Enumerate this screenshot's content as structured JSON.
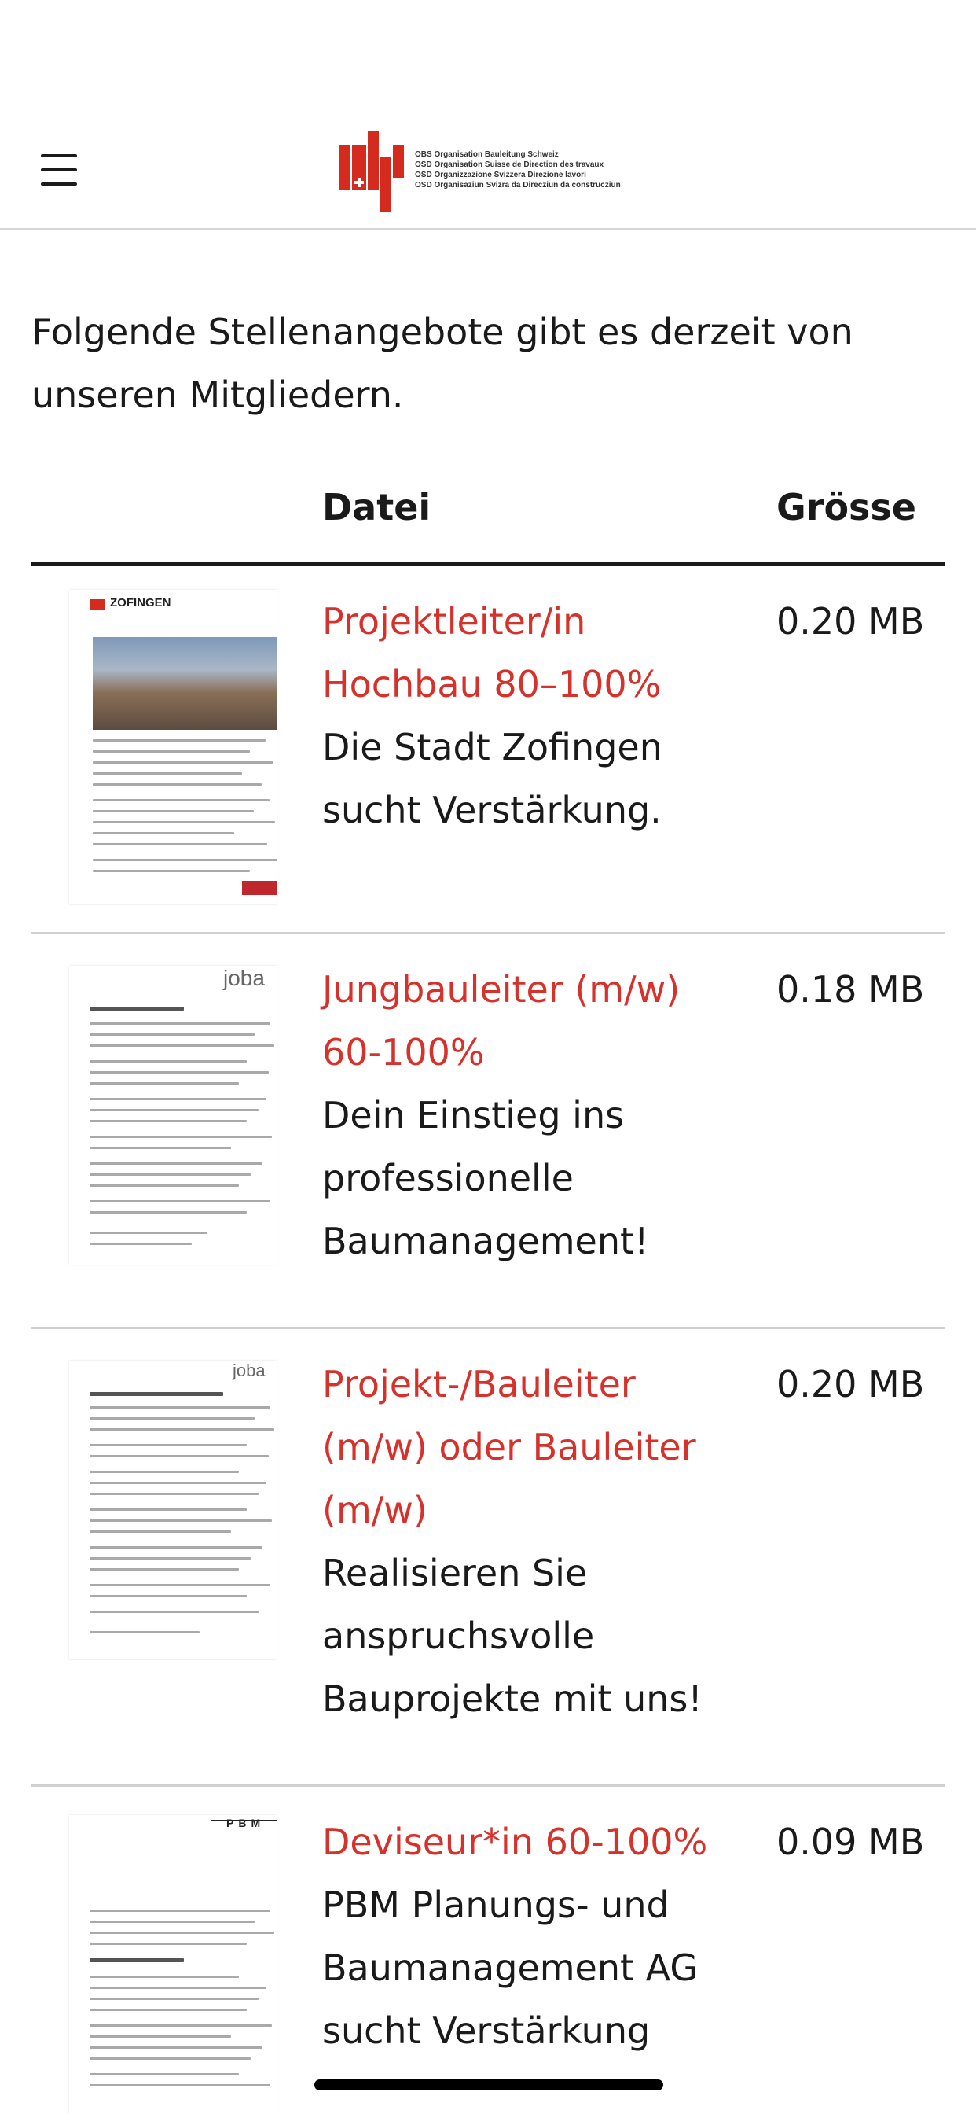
{
  "header": {
    "menu_icon": "hamburger-icon",
    "logo_lines": [
      "OBS Organisation Bauleitung Schweiz",
      "OSD Organisation Suisse de Direction des travaux",
      "OSD Organizzazione Svizzera Direzione lavori",
      "OSD Organisaziun Svizra da Direcziun da construcziun"
    ],
    "brand_color": "#d52b1e"
  },
  "intro": "Folgende Stellenangebote gibt es derzeit von unseren Mitgliedern.",
  "table": {
    "col_file": "Datei",
    "col_size": "Grösse",
    "rows": [
      {
        "thumb_label": "ZOFINGEN",
        "title": "Projektleiter/in Hochbau 80–100%",
        "description": "Die Stadt Zofingen sucht Verstärkung.",
        "size": "0.20 MB"
      },
      {
        "thumb_label": "joba",
        "title": "Jungbauleiter (m/w) 60-100%",
        "description": "Dein Einstieg ins professionelle Baumanagement!",
        "size": "0.18 MB"
      },
      {
        "thumb_label": "joba",
        "title": "Projekt-/Bauleiter (m/w) oder Bauleiter (m/w)",
        "description": "Realisieren Sie anspruchsvolle Bauprojekte mit uns!",
        "size": "0.20 MB"
      },
      {
        "thumb_label": "PBM",
        "title": "Deviseur*in 60-100%",
        "description": "PBM Planungs- und Baumanagement AG sucht Verstärkung",
        "size": "0.09 MB"
      }
    ]
  },
  "colors": {
    "link": "#d6312b",
    "text": "#1a1a1a",
    "divider": "#d0d0d0"
  }
}
